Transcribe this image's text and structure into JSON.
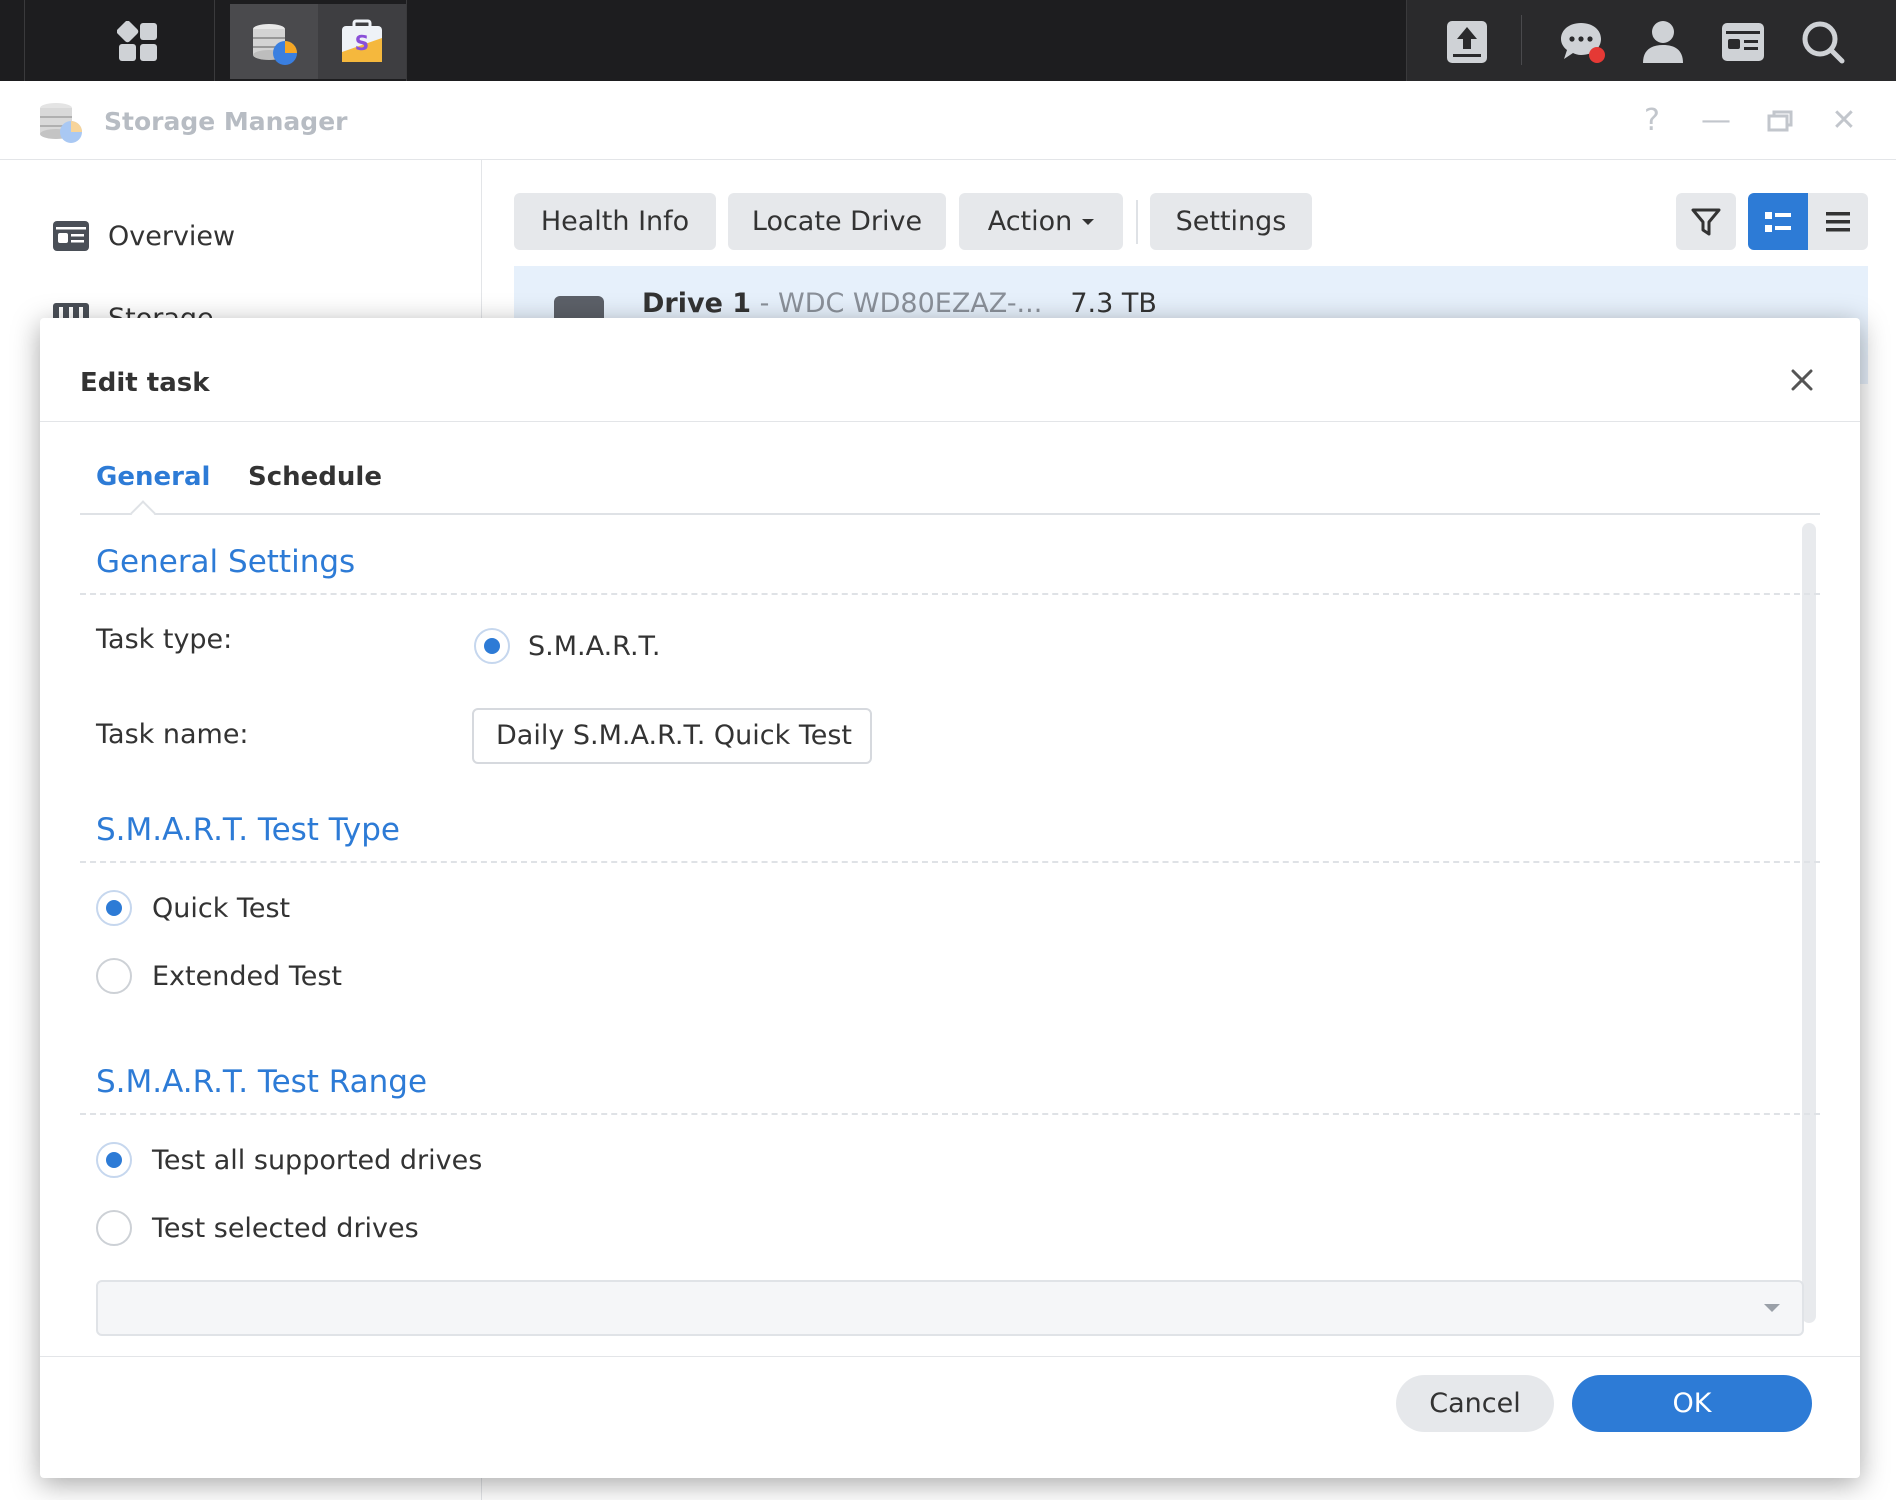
{
  "taskbar": {
    "icons": [
      "main-menu-icon",
      "storage-manager-icon",
      "package-center-icon",
      "upload-icon",
      "notifications-icon",
      "user-icon",
      "widgets-icon",
      "search-icon"
    ]
  },
  "window": {
    "title": "Storage Manager",
    "controls": {
      "help": "?",
      "minimize": "—",
      "close": "✕"
    }
  },
  "sidebar": {
    "items": [
      {
        "label": "Overview",
        "icon": "overview-icon"
      },
      {
        "label": "Storage",
        "icon": "storage-icon"
      }
    ]
  },
  "toolbar": {
    "health_info": "Health Info",
    "locate_drive": "Locate Drive",
    "action": "Action",
    "settings": "Settings"
  },
  "drive": {
    "name": "Drive 1",
    "model": " - WDC WD80EZAZ-...",
    "size": "7.3 TB"
  },
  "dialog": {
    "title": "Edit task",
    "tabs": [
      {
        "label": "General",
        "active": true
      },
      {
        "label": "Schedule",
        "active": false
      }
    ],
    "general_settings": {
      "title": "General Settings",
      "task_type_label": "Task type:",
      "task_type_value": "S.M.A.R.T.",
      "task_name_label": "Task name:",
      "task_name_value": "Daily S.M.A.R.T. Quick Test"
    },
    "test_type": {
      "title": "S.M.A.R.T. Test Type",
      "options": [
        {
          "label": "Quick Test",
          "selected": true
        },
        {
          "label": "Extended Test",
          "selected": false
        }
      ]
    },
    "test_range": {
      "title": "S.M.A.R.T. Test Range",
      "options": [
        {
          "label": "Test all supported drives",
          "selected": true
        },
        {
          "label": "Test selected drives",
          "selected": false
        }
      ],
      "drive_select_value": ""
    },
    "buttons": {
      "cancel": "Cancel",
      "ok": "OK"
    }
  },
  "colors": {
    "accent": "#2d7bd6",
    "taskbar": "#1d1d1f"
  }
}
